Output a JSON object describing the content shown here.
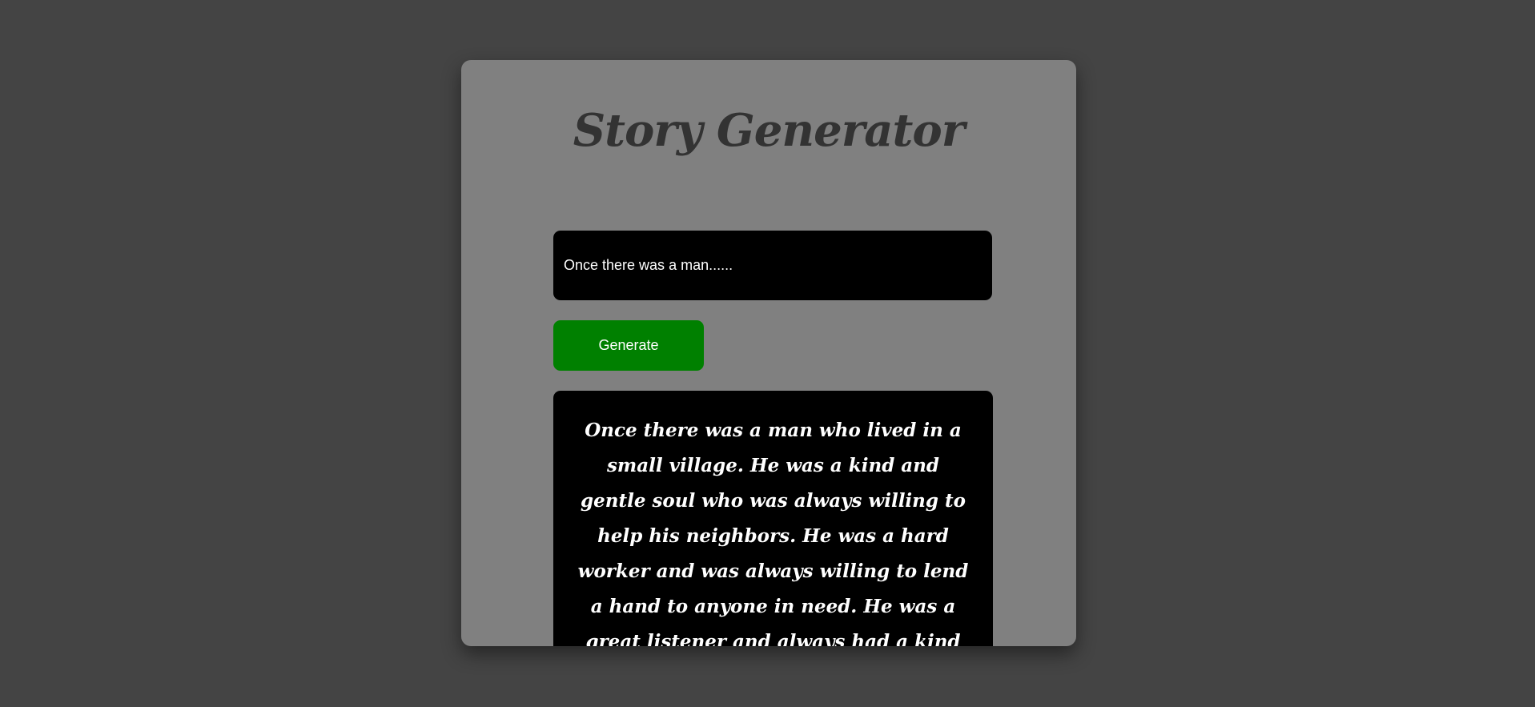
{
  "app": {
    "title": "Story Generator"
  },
  "prompt": {
    "value": "Once there was a man......"
  },
  "generate_button": {
    "label": "Generate"
  },
  "story": {
    "text": "Once there was a man who lived in a small village. He was a kind and gentle soul who was always willing to help his neighbors. He was a hard worker and was always willing to lend a hand to anyone in need. He was a great listener and always had a kind word for everyone he met. He was a great friend to all and was"
  },
  "colors": {
    "page_background": "#444444",
    "card_background": "#808080",
    "title_color": "#333333",
    "input_background": "#000000",
    "button_background": "#008000",
    "story_background": "#000000",
    "text_light": "#ffffff"
  }
}
